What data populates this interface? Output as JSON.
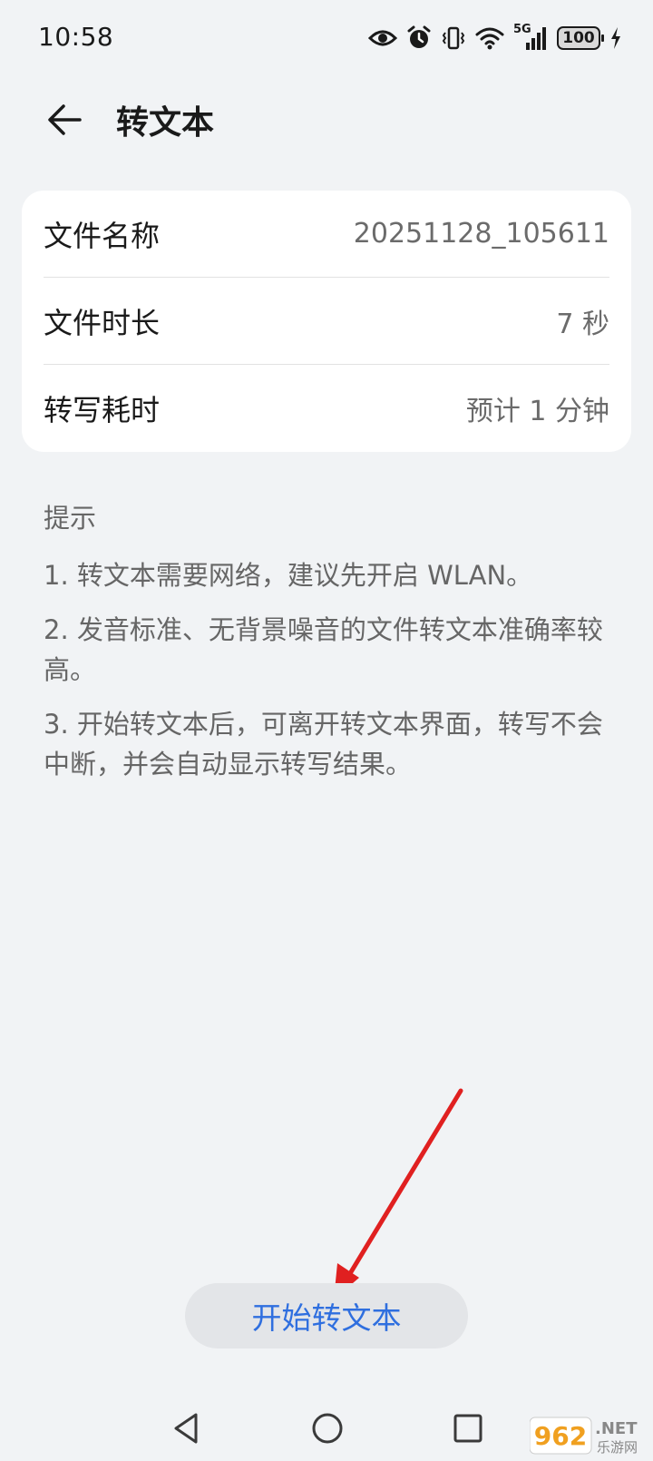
{
  "status_bar": {
    "time": "10:58",
    "network": "5G",
    "battery": "100",
    "icons": [
      "eye-icon",
      "alarm-icon",
      "vibrate-icon",
      "wifi-icon",
      "signal-icon",
      "battery-icon",
      "charging-icon"
    ]
  },
  "header": {
    "title": "转文本",
    "back_icon": "arrow-left-icon"
  },
  "info": {
    "rows": [
      {
        "label": "文件名称",
        "value": "20251128_105611"
      },
      {
        "label": "文件时长",
        "value": "7 秒"
      },
      {
        "label": "转写耗时",
        "value": "预计 1 分钟"
      }
    ]
  },
  "tips": {
    "title": "提示",
    "items": [
      "1. 转文本需要网络，建议先开启 WLAN。",
      "2. 发音标准、无背景噪音的文件转文本准确率较高。",
      "3. 开始转文本后，可离开转文本界面，转写不会中断，并会自动显示转写结果。"
    ]
  },
  "action": {
    "start_label": "开始转文本"
  },
  "watermark": {
    "brand": "962",
    "suffix": ".NET",
    "caption": "乐游网"
  },
  "colors": {
    "background": "#f1f3f5",
    "card": "#ffffff",
    "accent": "#2f6fdf",
    "annotation": "#e02020"
  }
}
